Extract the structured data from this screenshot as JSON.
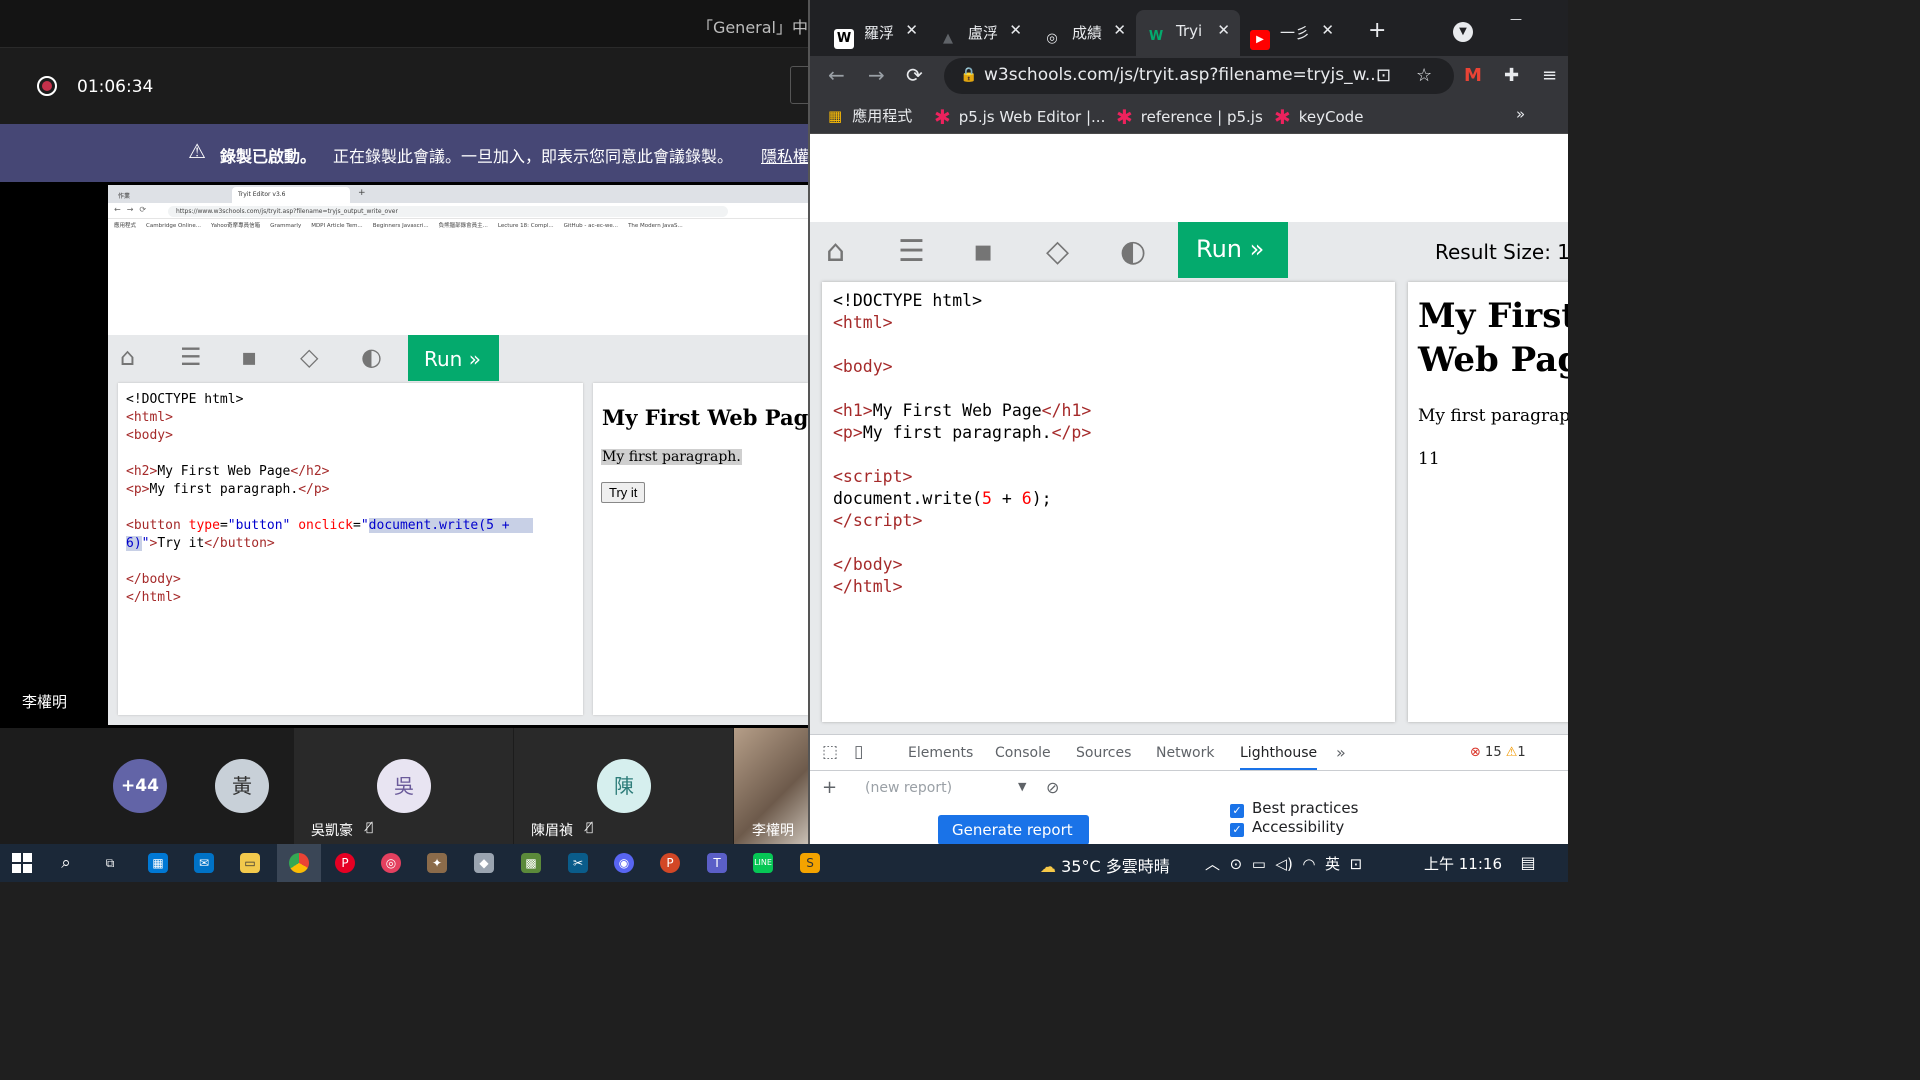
{
  "teams": {
    "meeting_title": "「General」中",
    "record_time": "01:06:34",
    "banner": {
      "title": "錄製已啟動。",
      "text": "正在錄製此會議。一旦加入，即表示您同意此會議錄製。",
      "link": "隱私權"
    },
    "presenter": "李權明",
    "participants": [
      {
        "initials": "+44"
      },
      {
        "initials": "黃"
      },
      {
        "initials": "吳",
        "name": "吳凱豪"
      },
      {
        "initials": "陳",
        "name": "陳眉禎"
      },
      {
        "name": "李權明"
      }
    ]
  },
  "shared_screen": {
    "tab1": "作業",
    "tab2": "Tryit Editor v3.6",
    "url": "https://www.w3schools.com/js/tryit.asp?filename=tryjs_output_write_over",
    "bookmarks": [
      "應用程式",
      "Cambridge Online...",
      "Yahoo奇摩專員信箱",
      "Grammarly",
      "MDPI Article Tem...",
      "Beginners Javascri...",
      "負熊腦部錄會員主...",
      "Lecture 18: Compl...",
      "GitHub - ac-ec-we...",
      "The Modern JavaS..."
    ],
    "run": "Run »",
    "result_heading": "My First Web Page",
    "result_para": "My first paragraph.",
    "result_button": "Try it"
  },
  "chrome": {
    "tabs": [
      {
        "label": "羅浮",
        "icon": "W"
      },
      {
        "label": "盧浮",
        "icon": "▲"
      },
      {
        "label": "成績",
        "icon": "◎"
      },
      {
        "label": "Tryi",
        "icon": "W"
      },
      {
        "label": "一彡",
        "icon": "▶"
      }
    ],
    "url": "w3schools.com/js/tryit.asp?filename=tryjs_w...",
    "bookmarks": [
      "應用程式",
      "p5.js Web Editor |...",
      "reference | p5.js",
      "keyCode"
    ],
    "run": "Run »",
    "result_size": "Result Size: 1",
    "result_heading_1": "My First",
    "result_heading_2": "Web Pag",
    "result_para": "My first paragraph.",
    "result_output": "11",
    "devtools": {
      "tabs": [
        "Elements",
        "Console",
        "Sources",
        "Network",
        "Lighthouse"
      ],
      "errors": "15",
      "warnings": "1",
      "new_report": "(new report)",
      "generate": "Generate report",
      "best_practices": "Best practices",
      "accessibility": "Accessibility"
    }
  },
  "taskbar": {
    "temp": "35°C",
    "weather": "多雲時晴",
    "ime": "英",
    "time": "上午 11:16"
  }
}
